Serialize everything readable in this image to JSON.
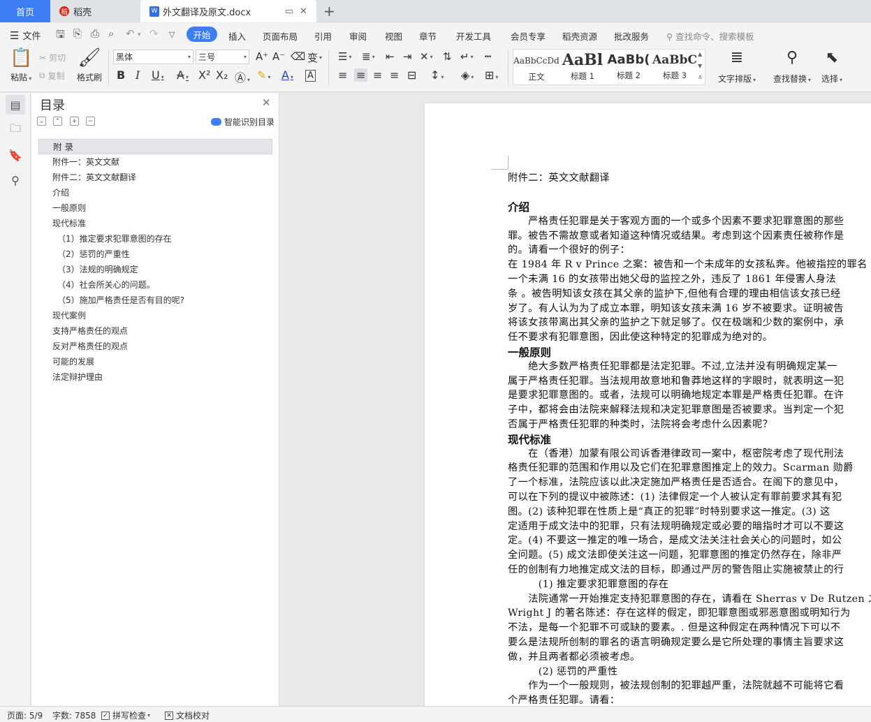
{
  "tabs": {
    "home": "首页",
    "docer": "稻壳",
    "doc": "外文翻译及原文.docx"
  },
  "menu": {
    "file": "文件",
    "items": [
      "开始",
      "插入",
      "页面布局",
      "引用",
      "审阅",
      "视图",
      "章节",
      "开发工具",
      "会员专享",
      "稻壳资源",
      "批改服务"
    ],
    "search": "查找命令、搜索模板"
  },
  "ribbon": {
    "paste": "粘贴",
    "cut": "剪切",
    "copy": "复制",
    "format_painter": "格式刷",
    "font_family": "黑体",
    "font_size": "三号",
    "styles": [
      {
        "sample": "AaBbCcDd",
        "name": "正文"
      },
      {
        "sample": "AaBl",
        "name": "标题 1"
      },
      {
        "sample": "AaBb(",
        "name": "标题 2"
      },
      {
        "sample": "AaBbC",
        "name": "标题 3"
      }
    ],
    "text_layout": "文字排版",
    "find_replace": "查找替换",
    "select": "选择"
  },
  "toc": {
    "title": "目录",
    "smart": "智能识别目录",
    "items": [
      {
        "label": "附 录",
        "level": 1,
        "selected": true
      },
      {
        "label": "附件一：英文文献",
        "level": 1
      },
      {
        "label": "附件二：英文文献翻译",
        "level": 1
      },
      {
        "label": "介绍",
        "level": 1
      },
      {
        "label": "一般原则",
        "level": 1
      },
      {
        "label": "现代标准",
        "level": 1
      },
      {
        "label": "（1）推定要求犯罪意图的存在",
        "level": 2
      },
      {
        "label": "（2）惩罚的严重性",
        "level": 2
      },
      {
        "label": "（3）法规的明确规定",
        "level": 2
      },
      {
        "label": "（4）社会所关心的问题。",
        "level": 2
      },
      {
        "label": "（5）施加严格责任是否有目的呢?",
        "level": 2
      },
      {
        "label": "现代案例",
        "level": 1
      },
      {
        "label": "支持严格责任的观点",
        "level": 1
      },
      {
        "label": "反对严格责任的观点",
        "level": 1
      },
      {
        "label": "可能的发展",
        "level": 1
      },
      {
        "label": "法定辩护理由",
        "level": 1
      }
    ]
  },
  "document": {
    "lines": [
      {
        "t": "附件二：英文文献翻译",
        "k": "p"
      },
      {
        "t": "介绍",
        "k": "h"
      },
      {
        "t": "　　严格责任犯罪是关于客观方面的一个或多个因素不要求犯罪意图的那些",
        "k": "p"
      },
      {
        "t": "罪。被告不需故意或者知道这种情况或结果。考虑到这个因素责任被称作是",
        "k": "p"
      },
      {
        "t": "的。请看一个很好的例子：",
        "k": "p"
      },
      {
        "t": "在 1984 年 R v Prince 之案：被告和一个未成年的女孩私奔。他被指控的罪名",
        "k": "p"
      },
      {
        "t": "一个未满 16 的女孩带出她父母的监控之外，违反了 1861 年侵害人身法",
        "k": "p"
      },
      {
        "t": "条 。被告明知该女孩在其父亲的监护下,但他有合理的理由相信该女孩已经",
        "k": "p"
      },
      {
        "t": "岁了。有人认为为了成立本罪，明知该女孩未满 16 岁不被要求。证明被告",
        "k": "p"
      },
      {
        "t": "将该女孩带离出其父亲的监护之下就足够了。仅在极端和少数的案例中，承",
        "k": "p"
      },
      {
        "t": "任不要求有犯罪意图，因此使这种特定的犯罪成为绝对的。",
        "k": "p"
      },
      {
        "t": "一般原则",
        "k": "h"
      },
      {
        "t": "　　绝大多数严格责任犯罪都是法定犯罪。不过,立法并没有明确规定某一",
        "k": "p"
      },
      {
        "t": "属于严格责任犯罪。当法规用故意地和鲁莽地这样的字眼时，就表明这一犯",
        "k": "p"
      },
      {
        "t": "是要求犯罪意图的。或者，法规可以明确地规定本罪是严格责任犯罪。在许",
        "k": "p"
      },
      {
        "t": "子中，都将会由法院来解释法规和决定犯罪意图是否被要求。当判定一个犯",
        "k": "p"
      },
      {
        "t": "否属于严格责任犯罪的种类时，法院将会考虑什么因素呢？",
        "k": "p"
      },
      {
        "t": "现代标准",
        "k": "h"
      },
      {
        "t": "　　在（香港）加蒙有限公司诉香港律政司一案中，枢密院考虑了现代刑法",
        "k": "p"
      },
      {
        "t": "格责任犯罪的范围和作用以及它们在犯罪意图推定上的效力。Scarman 勋爵",
        "k": "p"
      },
      {
        "t": "了一个标准，法院应该以此决定施加严格责任是否适合。在阁下的意见中，",
        "k": "p"
      },
      {
        "t": "可以在下列的提议中被陈述：(1) 法律假定一个人被认定有罪前要求其有犯",
        "k": "p"
      },
      {
        "t": "图。(2) 该种犯罪在性质上是“真正的犯罪”时特别要求这一推定。(3) 这",
        "k": "p"
      },
      {
        "t": "定适用于成文法中的犯罪，只有法规明确规定或必要的暗指时才可以不要这",
        "k": "p"
      },
      {
        "t": "定。(4) 不要这一推定的唯一场合，是成文法关注社会关心的问题时，如公",
        "k": "p"
      },
      {
        "t": "全问题。(5) 成文法即使关注这一问题，犯罪意图的推定仍然存在，除非严",
        "k": "p"
      },
      {
        "t": "任的创制有力地推定成文法的目标，即通过严厉的警告阻止实施被禁止的行",
        "k": "p"
      },
      {
        "t": "　　　(1) 推定要求犯罪意图的存在",
        "k": "p"
      },
      {
        "t": "　　法院通常一开始推定支持犯罪意图的存在，请看在 Sherras v De Rutzen 之",
        "k": "p"
      },
      {
        "t": "Wright J 的著名陈述：存在这样的假定，即犯罪意图或邪恶意图或明知行为",
        "k": "p"
      },
      {
        "t": "不法，是每一个犯罪不可或缺的要素。. 但是这种假定在两种情况下可以不",
        "k": "p"
      },
      {
        "t": "要么是法规所创制的罪名的语言明确规定要么是它所处理的事情主旨要求这",
        "k": "p"
      },
      {
        "t": "做，并且两者都必须被考虑。",
        "k": "p"
      },
      {
        "t": "　　　(2) 惩罚的严重性",
        "k": "p"
      },
      {
        "t": "　　作为一个一般规则，被法规创制的犯罪越严重，法院就越不可能将它看",
        "k": "p"
      },
      {
        "t": "个严格责任犯罪。请看：",
        "k": "p"
      }
    ]
  },
  "status": {
    "page": "页面: 5/9",
    "words": "字数: 7858",
    "spell": "拼写检查",
    "proof": "文档校对"
  },
  "colors": {
    "accent": "#3e7ef5"
  }
}
